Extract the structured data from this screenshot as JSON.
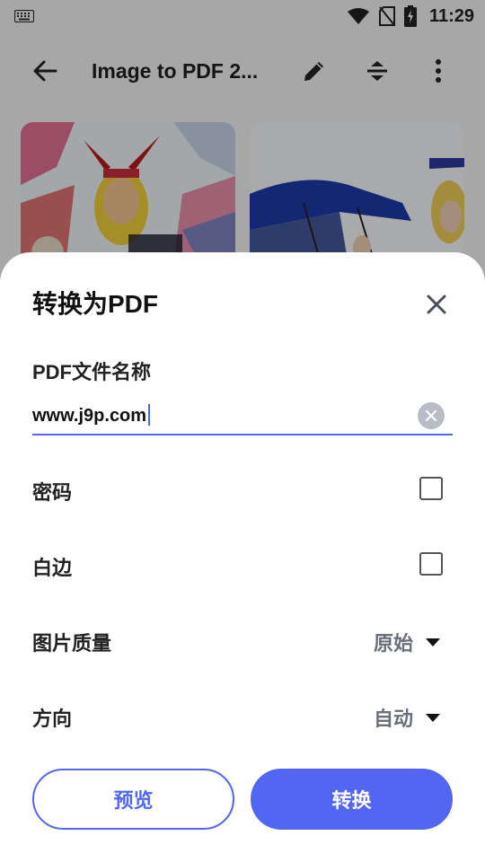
{
  "status_bar": {
    "time": "11:29",
    "icons": [
      "keyboard-icon",
      "wifi-icon",
      "no-sim-icon",
      "battery-charging-icon"
    ]
  },
  "toolbar": {
    "title": "Image to PDF 2...",
    "icons": [
      "back-arrow-icon",
      "pencil-icon",
      "sort-icon",
      "more-vert-icon"
    ]
  },
  "sheet": {
    "title": "转换为PDF",
    "filename_label": "PDF文件名称",
    "filename_value": "www.j9p.com",
    "password_label": "密码",
    "password_checked": false,
    "margin_label": "白边",
    "margin_checked": false,
    "quality_label": "图片质量",
    "quality_value": "原始",
    "orientation_label": "方向",
    "orientation_value": "自动",
    "preview_button": "预览",
    "convert_button": "转换"
  },
  "colors": {
    "accent": "#5266f2",
    "scrim": "rgba(0,0,0,0.32)",
    "dropdown_text": "#6b6f7a"
  }
}
